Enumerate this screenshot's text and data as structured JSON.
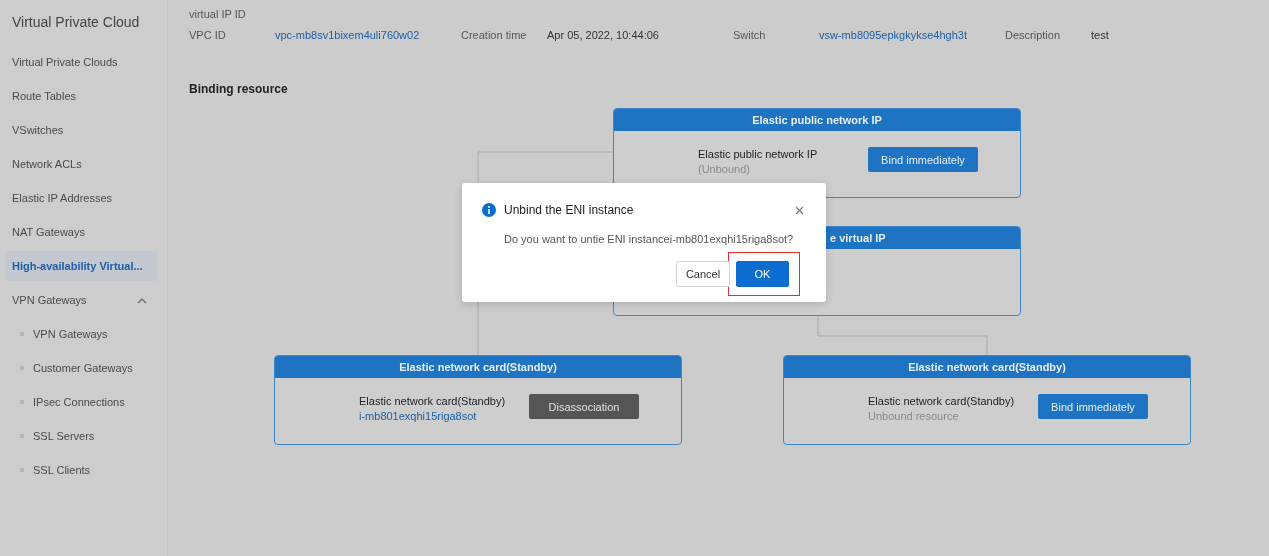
{
  "sidebar": {
    "title": "Virtual Private Cloud",
    "items": [
      {
        "label": "Virtual Private Clouds",
        "selected": false
      },
      {
        "label": "Route Tables",
        "selected": false
      },
      {
        "label": "VSwitches",
        "selected": false
      },
      {
        "label": "Network ACLs",
        "selected": false
      },
      {
        "label": "Elastic IP Addresses",
        "selected": false
      },
      {
        "label": "NAT Gateways",
        "selected": false
      },
      {
        "label": "High-availability Virtual...",
        "selected": true
      },
      {
        "label": "VPN Gateways",
        "selected": false,
        "expanded": true,
        "children": [
          {
            "label": "VPN Gateways",
            "selected": false
          },
          {
            "label": "Customer Gateways",
            "selected": false
          },
          {
            "label": "IPsec Connections",
            "selected": false
          },
          {
            "label": "SSL Servers",
            "selected": false
          },
          {
            "label": "SSL Clients",
            "selected": false
          }
        ]
      }
    ]
  },
  "details": {
    "rows": [
      [
        {
          "label": "virtual IP ID"
        }
      ],
      [
        {
          "label": "VPC ID",
          "value": "vpc-mb8sv1bixem4uli760w02",
          "link": true
        },
        {
          "label": "Creation time",
          "value": "Apr 05, 2022, 10:44:06",
          "link": false
        },
        {
          "label": "Switch",
          "value": "vsw-mb8095epkgkykse4hgh3t",
          "link": true
        },
        {
          "label": "Description",
          "value": "test",
          "link": false
        }
      ]
    ]
  },
  "binding": {
    "title": "Binding resource",
    "cards": [
      {
        "title": "Elastic public network IP",
        "covered": false,
        "name": "Elastic public network IP",
        "status": "(Unbound)",
        "link": false,
        "action": {
          "label": "Bind immediately",
          "kind": "primary"
        }
      },
      {
        "title": "e virtual IP",
        "covered": true
      },
      {
        "title": "Elastic network card(Standby)",
        "covered": false,
        "name": "Elastic network card(Standby)",
        "status": "i-mb801exqhi15riga8sot",
        "link": true,
        "action": {
          "label": "Disassociation",
          "kind": "dark"
        }
      },
      {
        "title": "Elastic network card(Standby)",
        "covered": false,
        "name": "Elastic network card(Standby)",
        "status": "Unbound resource",
        "link": false,
        "action": {
          "label": "Bind immediately",
          "kind": "primary"
        }
      }
    ]
  },
  "dialog": {
    "title": "Unbind the ENI instance",
    "message": "Do you want to untie ENI instancei-mb801exqhi15riga8sot?",
    "buttons": [
      {
        "label": "Cancel",
        "kind": "default",
        "highlighted": false
      },
      {
        "label": "OK",
        "kind": "primary",
        "highlighted": true
      }
    ]
  }
}
